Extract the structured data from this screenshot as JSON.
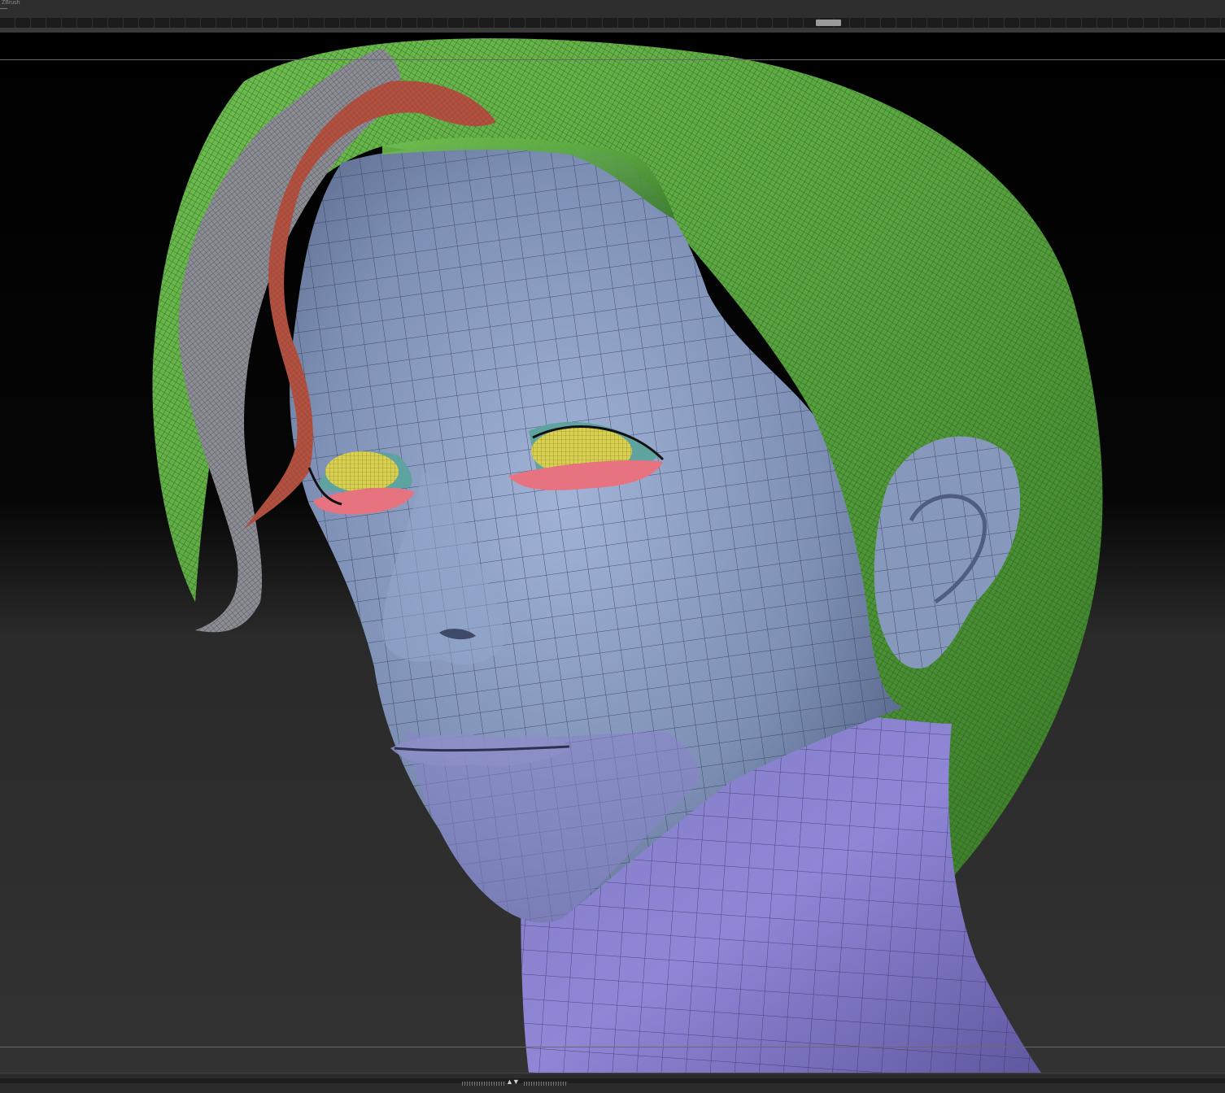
{
  "window": {
    "top_label": "ZBrush",
    "bottom_arrows": "▲▼"
  },
  "viewport": {
    "content": "sculpt",
    "polygroups": [
      {
        "name": "face-skin",
        "color": "#8193b7"
      },
      {
        "name": "neck",
        "color": "#8a80c9"
      },
      {
        "name": "hair",
        "color": "#5da845"
      },
      {
        "name": "hair-strand-grey",
        "color": "#8a8a92"
      },
      {
        "name": "hair-strand-red",
        "color": "#b74f3f"
      },
      {
        "name": "eyes",
        "color": "#d8d050"
      },
      {
        "name": "lower-lids",
        "color": "#e87380"
      },
      {
        "name": "eyelashes",
        "color": "#5fa3a0"
      }
    ],
    "wireframe": true
  }
}
